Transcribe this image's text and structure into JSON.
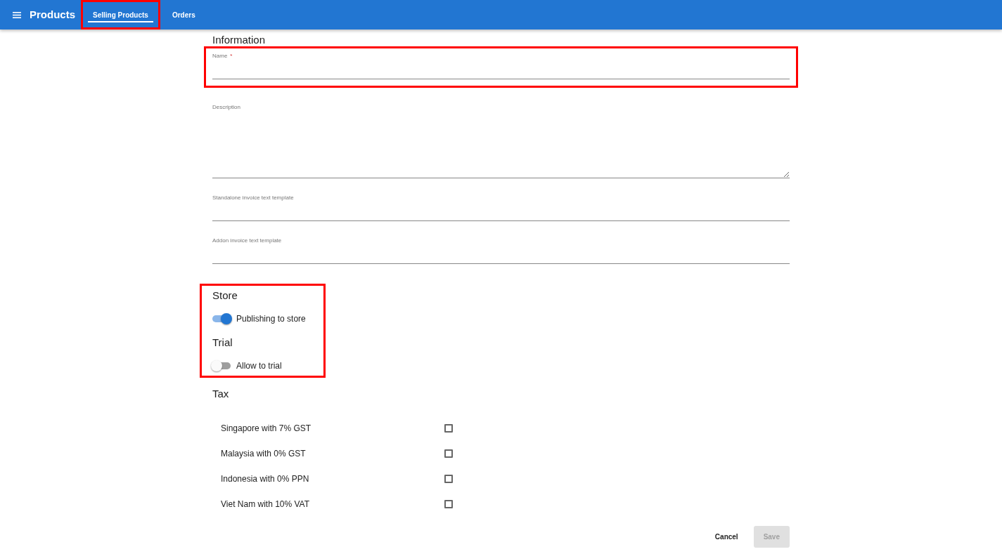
{
  "app_bar": {
    "title": "Products",
    "tabs": [
      {
        "label": "Selling Products",
        "selected": true,
        "highlighted": true
      },
      {
        "label": "Orders",
        "selected": false,
        "highlighted": false
      }
    ]
  },
  "information": {
    "title": "Information",
    "fields": [
      {
        "label": "Name",
        "required_mark": "*",
        "kind": "input",
        "highlighted": true
      },
      {
        "label": "Description",
        "kind": "textarea",
        "highlighted": false
      },
      {
        "label": "Standalone invoice text template",
        "kind": "input",
        "highlighted": false
      },
      {
        "label": "Addon invoice text template",
        "kind": "input",
        "highlighted": false
      }
    ]
  },
  "toggle_sections": {
    "highlighted": true,
    "sections": [
      {
        "title": "Store",
        "toggle": {
          "label": "Publishing to store",
          "on": true
        }
      },
      {
        "title": "Trial",
        "toggle": {
          "label": "Allow to trial",
          "on": false
        }
      }
    ]
  },
  "tax": {
    "title": "Tax",
    "options": [
      {
        "label": "Singapore with 7% GST",
        "checked": false
      },
      {
        "label": "Malaysia with 0% GST",
        "checked": false
      },
      {
        "label": "Indonesia with 0% PPN",
        "checked": false
      },
      {
        "label": "Viet Nam with 10% VAT",
        "checked": false
      }
    ]
  },
  "actions": [
    {
      "label": "Cancel",
      "kind": "text",
      "disabled": false
    },
    {
      "label": "Save",
      "kind": "filled",
      "disabled": true
    }
  ]
}
